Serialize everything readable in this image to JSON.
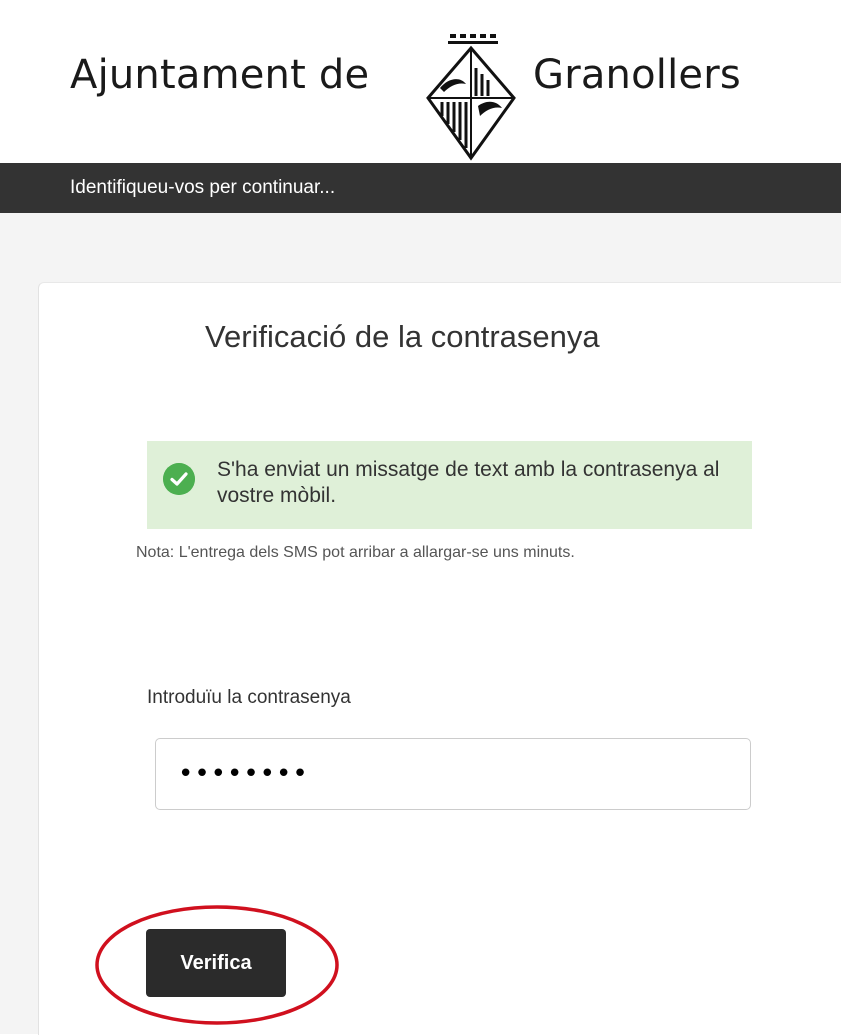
{
  "header": {
    "brand_left": "Ajuntament de",
    "brand_right": "Granollers",
    "crest_icon": "municipal-crest-icon"
  },
  "subbar": {
    "text": "Identifiqueu-vos per continuar..."
  },
  "card": {
    "title": "Verificació de la contrasenya",
    "alert": {
      "icon": "check-circle-icon",
      "text": "S'ha enviat un missatge de text amb la contrasenya al vostre mòbil."
    },
    "note": "Nota: L'entrega dels SMS pot arribar a allargar-se uns minuts.",
    "password": {
      "label": "Introduïu la contrasenya",
      "value": "••••••••"
    },
    "verify_button": "Verifica"
  },
  "colors": {
    "subbar": "#333333",
    "alert_bg": "#dff0d8",
    "check": "#4caf50",
    "button": "#2b2b2b",
    "highlight": "#d0101e"
  }
}
